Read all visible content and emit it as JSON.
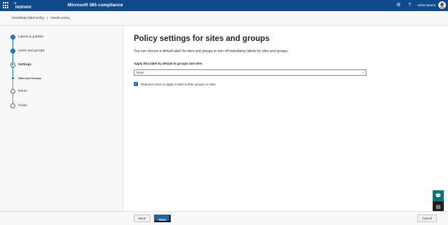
{
  "header": {
    "brand": "INSPARK",
    "app_title": "Microsoft 365 compliance",
    "settings_icon": "gear-icon",
    "help_icon": "question-icon",
    "user_name": "Administrator"
  },
  "breadcrumb": {
    "items": [
      "Sensitivity label policy",
      "Create policy"
    ],
    "separator": ">"
  },
  "wizard": {
    "steps": [
      {
        "label": "Labels to publish",
        "state": "done"
      },
      {
        "label": "Users and groups",
        "state": "done"
      },
      {
        "label": "Settings",
        "state": "current"
      },
      {
        "label": "Sites and Groups",
        "state": "current-sub"
      },
      {
        "label": "Name",
        "state": "todo"
      },
      {
        "label": "Finish",
        "state": "todo"
      }
    ]
  },
  "main": {
    "title": "Policy settings for sites and groups",
    "description": "You can choose a default label for sites and groups or turn off mandatory labels for sites and groups.",
    "default_label_field": {
      "label": "Apply this label by default to groups and sites",
      "value": "None"
    },
    "require_label_checkbox": {
      "checked": true,
      "label": "Requires users to apply a label to their groups or sites"
    }
  },
  "footer": {
    "back_label": "Back",
    "next_label": "Next",
    "cancel_label": "Cancel"
  },
  "colors": {
    "topbar": "#0f4a8c",
    "accent": "#0f6cbd",
    "help_fab": "#03787c",
    "feedback_fab": "#201f1e"
  }
}
